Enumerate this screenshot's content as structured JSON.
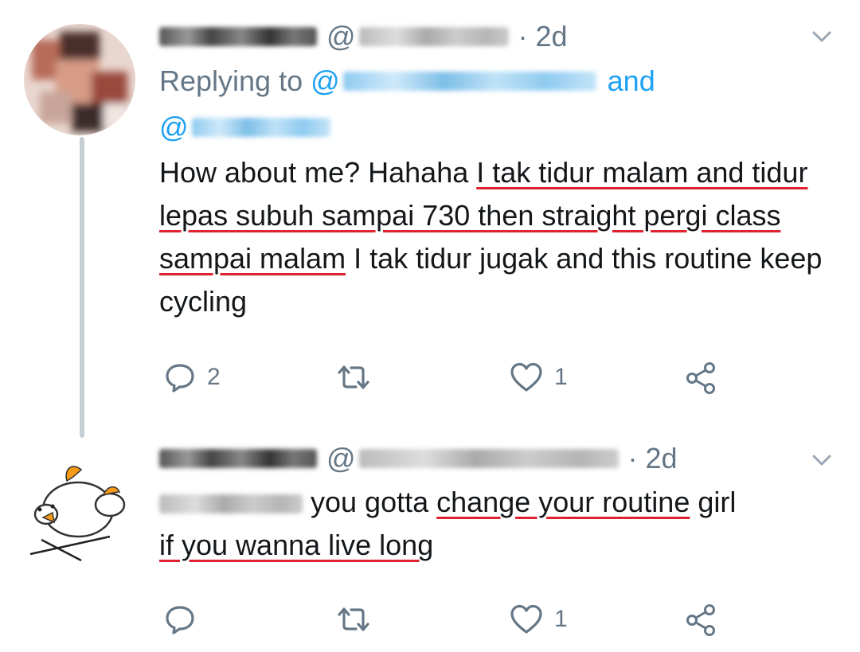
{
  "tweets": [
    {
      "author_handle_prefix": "@",
      "time": "· 2d",
      "replying_label": "Replying to",
      "replying_at": "@",
      "replying_and": "and",
      "replying_at2": "@",
      "body": {
        "p1": "How about me? Hahaha ",
        "u1": "I tak tidur malam and tidur lepas subuh sampai 730 then straight pergi class sampai malam",
        "p2": " I tak tidur jugak and this routine keep cycling"
      },
      "reply_count": "2",
      "retweet_count": "",
      "like_count": "1"
    },
    {
      "author_handle_prefix": "@",
      "time": "· 2d",
      "body": {
        "p1": " you gotta ",
        "u1": "change your routine",
        "p2": " girl ",
        "u2": "if you wanna live long"
      },
      "reply_count": "",
      "retweet_count": "",
      "like_count": "1"
    }
  ],
  "icons": [
    "reply-icon",
    "retweet-icon",
    "like-icon",
    "share-icon",
    "chevron-down-icon"
  ],
  "colors": {
    "text": "#14171a",
    "muted": "#657786",
    "link": "#1da1f2",
    "underline": "#e0242f",
    "thread": "#c4cfd6"
  }
}
